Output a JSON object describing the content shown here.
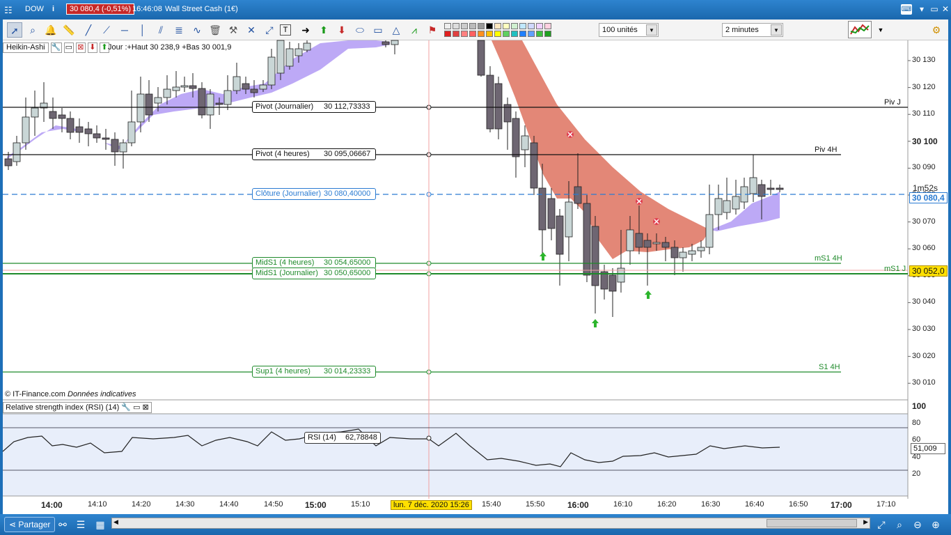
{
  "titlebar": {
    "menu_icon": "menu-icon",
    "instrument": "DOW",
    "info_icon": "info-icon",
    "price_change": "30 080,4 (-0,51%)",
    "time": "16:46:08",
    "name": "Wall Street Cash (1€)"
  },
  "toolbar": {
    "units": "100 unités",
    "interval": "2 minutes"
  },
  "chart": {
    "indicator_name": "Heikin-Ashi",
    "day_range": "Jour :+Haut 30 238,9 +Bas 30 001,9",
    "copyright": "© IT-Finance.com",
    "disclaimer": "Données indicatives",
    "countdown": "1m52s",
    "last_price": "30 080,4",
    "crosshair_price": "30 052,0",
    "crosshair_time": "lun. 7 déc. 2020 15:26"
  },
  "price_axis": [
    "30 130",
    "30 120",
    "30 110",
    "30 100",
    "30 090",
    "30 080",
    "30 070",
    "30 060",
    "30 050",
    "30 040",
    "30 030",
    "30 020",
    "30 010"
  ],
  "levels": [
    {
      "label": "Pivot (Journalier)",
      "value": "30 112,73333",
      "tag": "Piv J",
      "color": "#111111"
    },
    {
      "label": "Pivot (4 heures)",
      "value": "30 095,06667",
      "tag": "Piv 4H",
      "color": "#111111"
    },
    {
      "label": "Clôture (Journalier)",
      "value": "30 080,40000",
      "tag": "",
      "color": "#2a7bd2"
    },
    {
      "label": "MidS1 (4 heures)",
      "value": "30 054,65000",
      "tag": "mS1 4H",
      "color": "#1e8a2a"
    },
    {
      "label": "MidS1 (Journalier)",
      "value": "30 050,65000",
      "tag": "mS1 J",
      "color": "#1e8a2a"
    },
    {
      "label": "Sup1 (4 heures)",
      "value": "30 014,23333",
      "tag": "S1 4H",
      "color": "#1e8a2a"
    }
  ],
  "rsi": {
    "title": "Relative strength index (RSI) (14)",
    "label": "RSI (14)",
    "value": "62,78848",
    "last": "51,009",
    "axis": [
      "100",
      "80",
      "60",
      "40",
      "20"
    ]
  },
  "time_axis": [
    {
      "t": "14:00",
      "bold": true
    },
    {
      "t": "14:10",
      "bold": false
    },
    {
      "t": "14:20",
      "bold": false
    },
    {
      "t": "14:30",
      "bold": false
    },
    {
      "t": "14:40",
      "bold": false
    },
    {
      "t": "14:50",
      "bold": false
    },
    {
      "t": "15:00",
      "bold": true
    },
    {
      "t": "15:10",
      "bold": false
    },
    {
      "t": "15:40",
      "bold": false
    },
    {
      "t": "15:50",
      "bold": false
    },
    {
      "t": "16:00",
      "bold": true
    },
    {
      "t": "16:10",
      "bold": false
    },
    {
      "t": "16:20",
      "bold": false
    },
    {
      "t": "16:30",
      "bold": false
    },
    {
      "t": "16:40",
      "bold": false
    },
    {
      "t": "16:50",
      "bold": false
    },
    {
      "t": "17:00",
      "bold": true
    },
    {
      "t": "17:10",
      "bold": false
    }
  ],
  "bottom": {
    "share": "Partager"
  },
  "colors": {
    "bull": "#c9d6d6",
    "bear": "#6e6672",
    "cloud_up": "#b6a0f5",
    "cloud_down": "#e07a68"
  }
}
